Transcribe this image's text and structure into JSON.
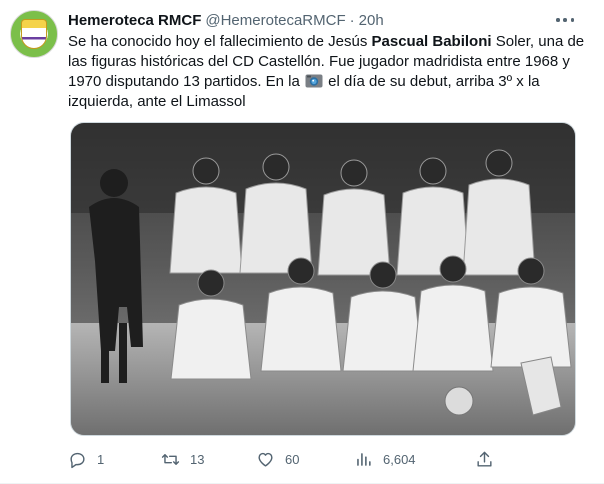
{
  "tweet": {
    "name": "Hemeroteca RMCF",
    "handle": "@HemerotecaRMCF",
    "separator": "·",
    "time": "20h",
    "text_part1": "Se ha conocido hoy el fallecimiento de Jesús ",
    "text_bold": "Pascual Babiloni",
    "text_part2": " Soler, una de las figuras históricas del CD Castellón. Fue jugador madridista entre 1968 y 1970 disputando 13 partidos. En la ",
    "text_part3": " el día de su debut, arriba 3º x la izquierda, ante el Limassol",
    "inline_icon": "camera-icon"
  },
  "actions": {
    "replies": "1",
    "retweets": "13",
    "likes": "60",
    "views": "6,604"
  },
  "icons": [
    "reply-icon",
    "retweet-icon",
    "like-icon",
    "views-icon",
    "share-icon",
    "more-icon"
  ],
  "colors": {
    "text": "#0f1419",
    "secondary": "#536471",
    "border": "#cfd9de"
  }
}
